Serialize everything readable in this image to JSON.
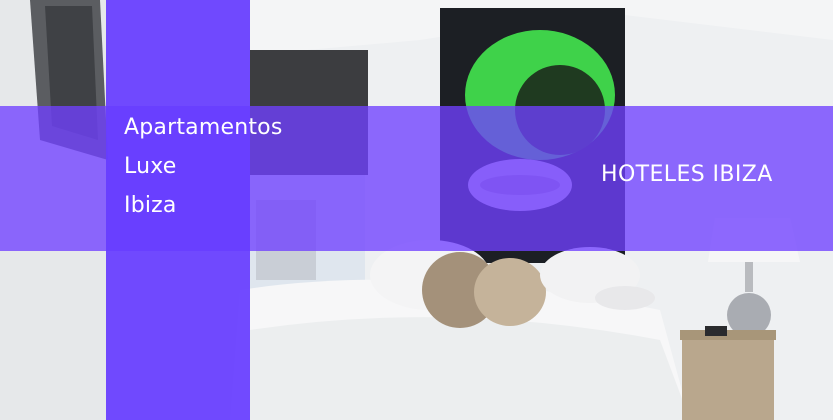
{
  "hero": {
    "title_lines": [
      "Apartamentos",
      "Luxe",
      "Ibiza"
    ],
    "category_label": "HOTELES IBIZA"
  },
  "colors": {
    "overlay_purple": "#6f40ff",
    "column_purple": "#663cff",
    "text": "#ffffff"
  }
}
